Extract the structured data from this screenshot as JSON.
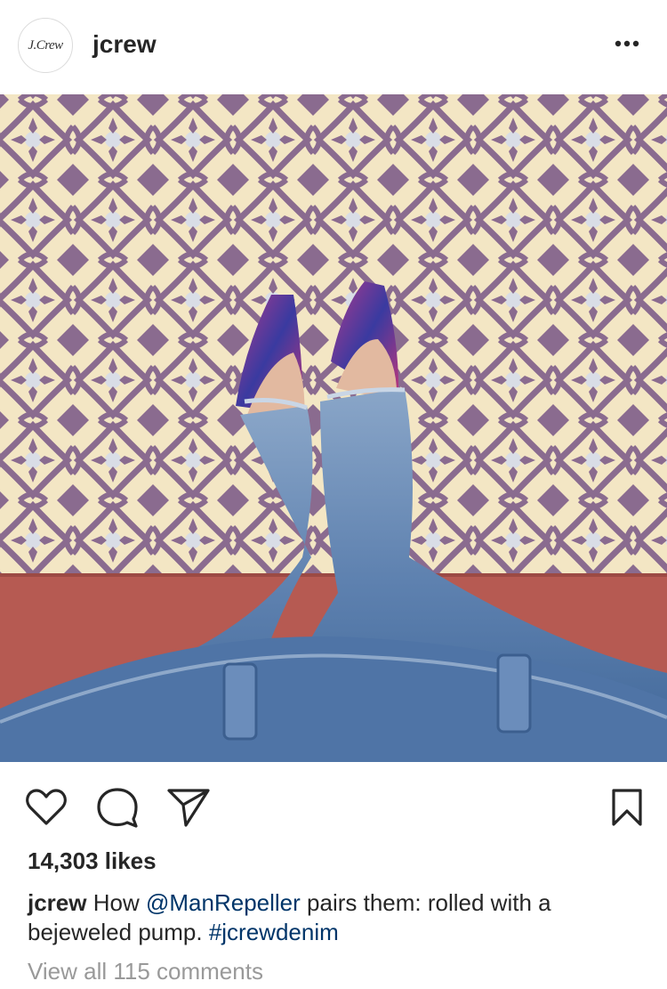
{
  "post": {
    "avatar_text": "J.Crew",
    "username": "jcrew",
    "more_icon": "more-horizontal-icon",
    "actions": {
      "like_icon": "heart-icon",
      "comment_icon": "comment-icon",
      "share_icon": "paper-plane-icon",
      "save_icon": "bookmark-icon"
    },
    "likes": "14,303 likes",
    "caption": {
      "username": "jcrew",
      "text_1": "How ",
      "mention": "@ManRepeller",
      "text_2": " pairs them: rolled with a bejeweled pump. ",
      "hashtag": "#jcrewdenim"
    },
    "view_comments": "View all 115 comments"
  },
  "colors": {
    "text": "#262626",
    "link": "#003569",
    "muted": "#999999",
    "tile_purple": "#8a6b8f",
    "tile_cream": "#f3e6c4",
    "denim": "#5b7fae"
  }
}
